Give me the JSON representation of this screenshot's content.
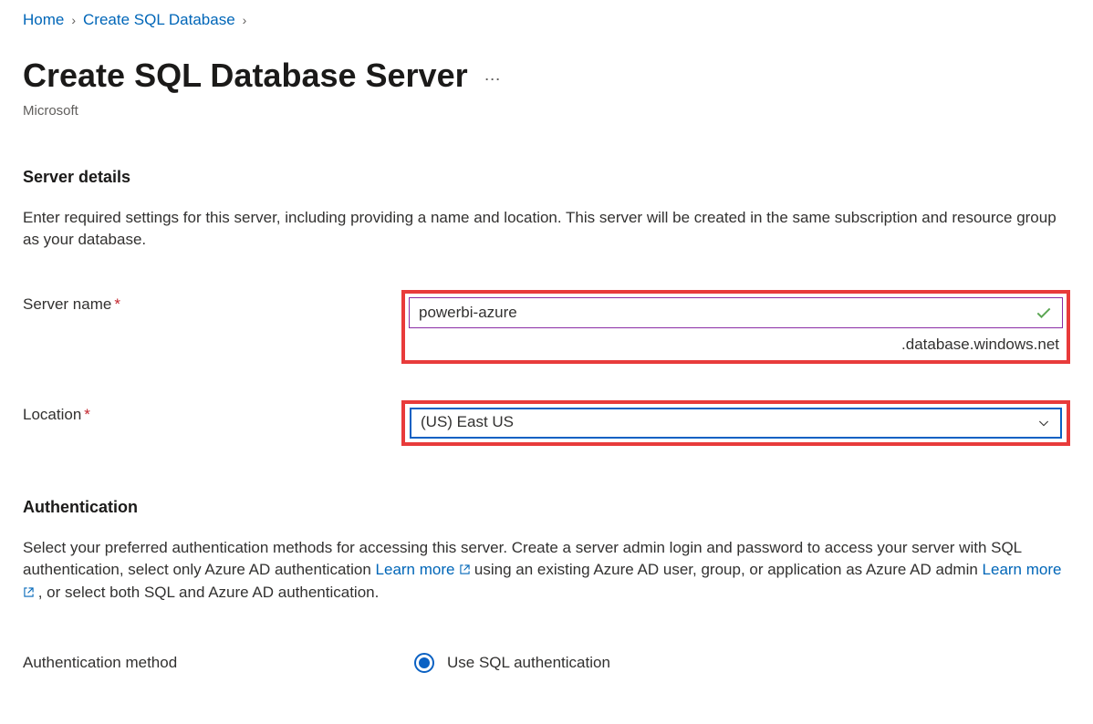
{
  "breadcrumb": {
    "home": "Home",
    "create_sql_db": "Create SQL Database"
  },
  "page": {
    "title": "Create SQL Database Server",
    "subtitle": "Microsoft"
  },
  "server_details": {
    "heading": "Server details",
    "description": "Enter required settings for this server, including providing a name and location. This server will be created in the same subscription and resource group as your database.",
    "server_name_label": "Server name",
    "server_name_value": "powerbi-azure",
    "server_name_suffix": ".database.windows.net",
    "location_label": "Location",
    "location_value": "(US) East US"
  },
  "authentication": {
    "heading": "Authentication",
    "desc_part1": "Select your preferred authentication methods for accessing this server. Create a server admin login and password to access your server with SQL authentication, select only Azure AD authentication ",
    "learn_more_1": "Learn more",
    "desc_part2": " using an existing Azure AD user, group, or application as Azure AD admin ",
    "learn_more_2": "Learn more",
    "desc_part3": " , or select both SQL and Azure AD authentication.",
    "method_label": "Authentication method",
    "option_sql": "Use SQL authentication"
  }
}
